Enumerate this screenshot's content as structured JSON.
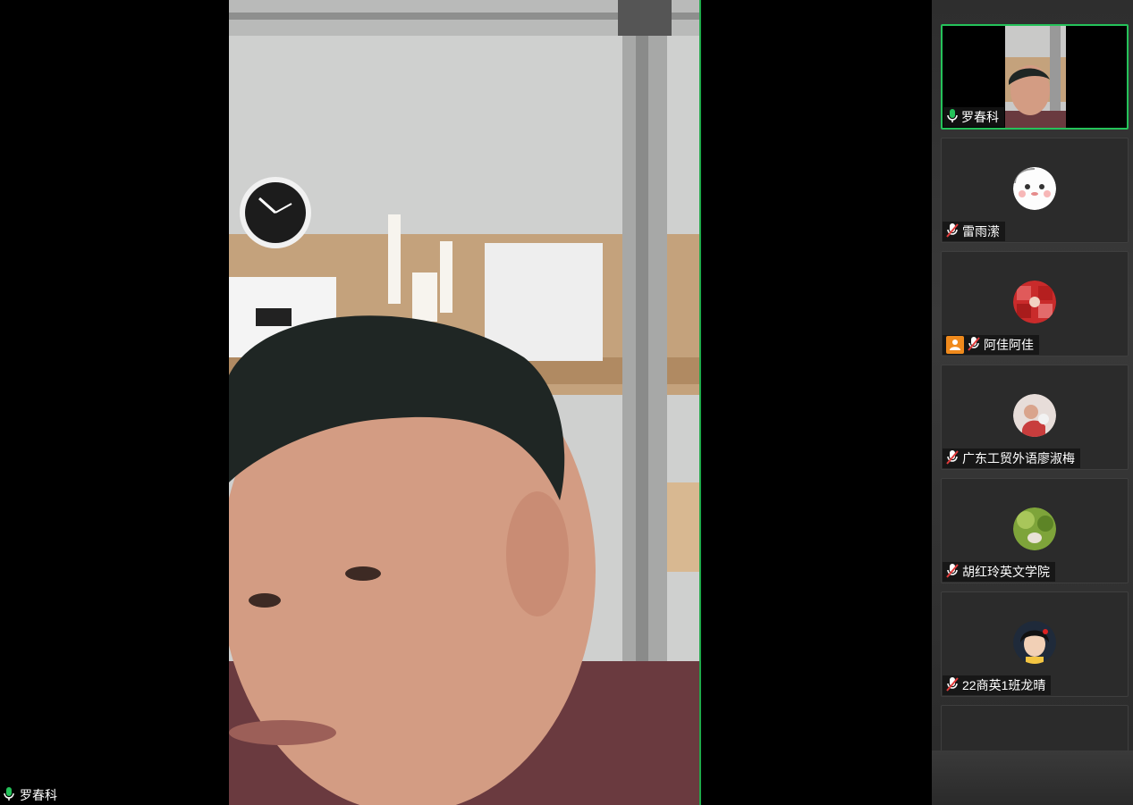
{
  "meeting": {
    "speaker_name": "罗春科"
  },
  "participants": [
    {
      "name": "罗春科",
      "mic": "on",
      "video": "on"
    },
    {
      "name": "雷雨潆",
      "mic": "muted",
      "video": "off"
    },
    {
      "name": "阿佳阿佳",
      "mic": "muted",
      "video": "off",
      "host": true
    },
    {
      "name": "广东工贸外语廖淑梅",
      "mic": "muted",
      "video": "off"
    },
    {
      "name": "胡红玲英文学院",
      "mic": "muted",
      "video": "off"
    },
    {
      "name": "22商英1班龙晴",
      "mic": "muted",
      "video": "off"
    },
    {
      "name": "",
      "mic": "muted",
      "video": "off"
    }
  ],
  "colors": {
    "active_speaker": "#25c25a",
    "mic_on": "#25c25a",
    "host_badge": "#f08a1c",
    "tile_bg": "#2b2b2b"
  },
  "icons": {
    "mic_on": "mic-icon",
    "mic_muted": "mic-muted-icon",
    "host": "host-person-icon"
  }
}
